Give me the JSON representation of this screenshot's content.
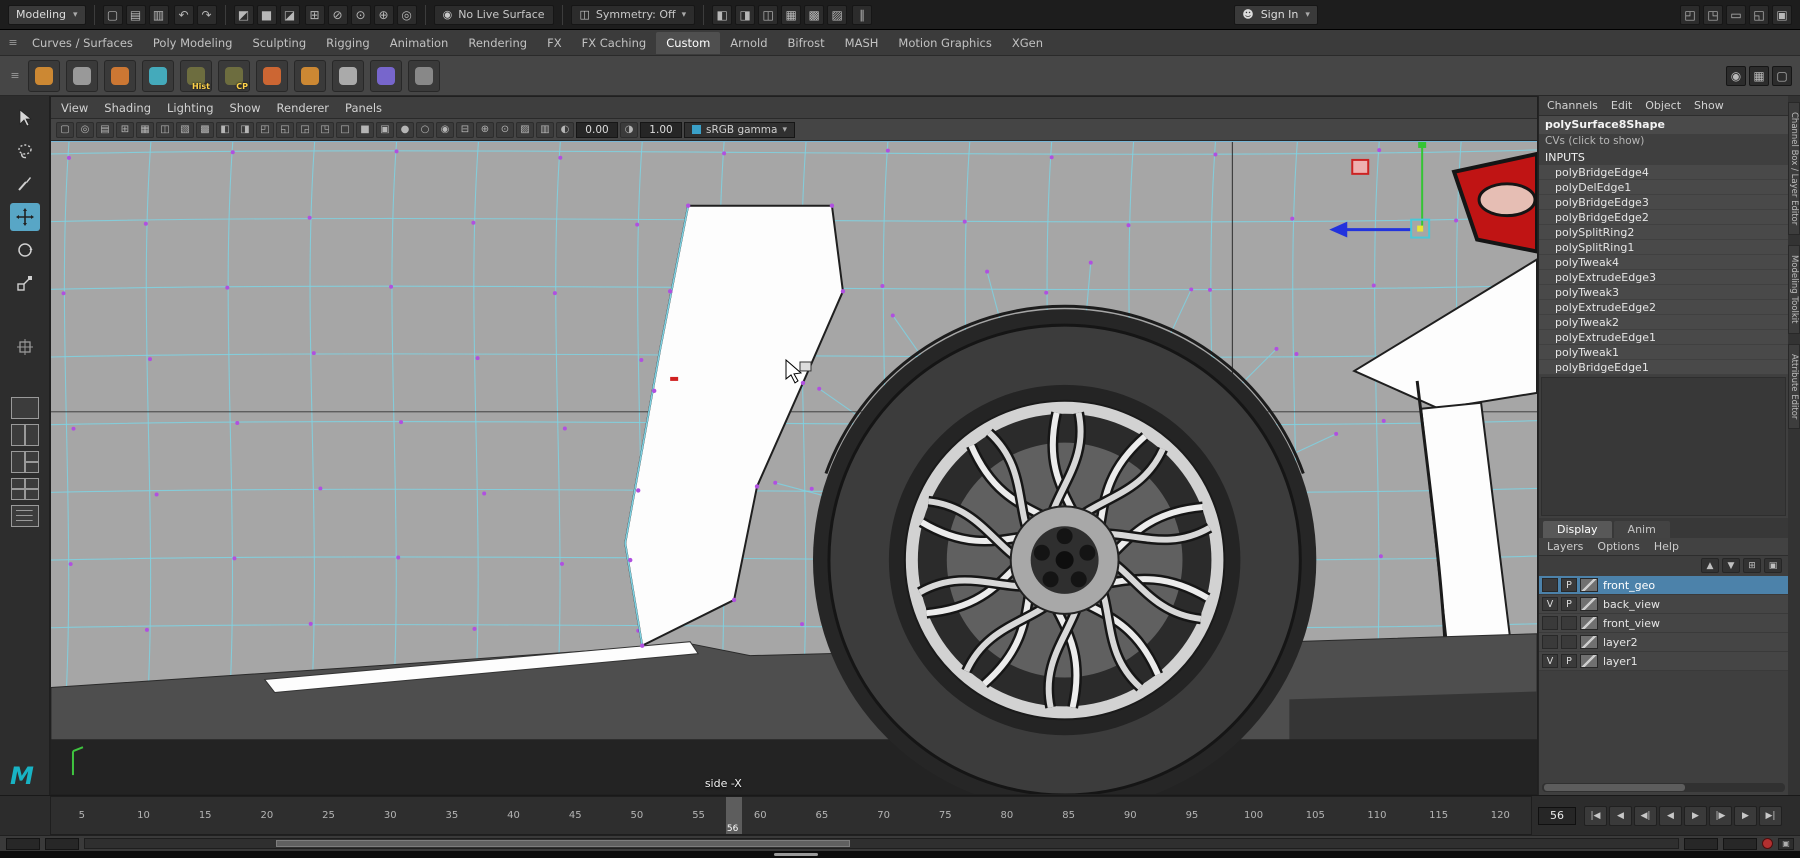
{
  "topbar": {
    "menuset_label": "Modeling",
    "caret": "▾",
    "hamburger_glyph": "≡",
    "live_surface_label": "No Live Surface",
    "symmetry_label": "Symmetry: Off",
    "sign_in_label": "Sign In",
    "pause_glyph": "∥",
    "person_glyph": "☻",
    "live_icon_glyph": "◉",
    "symmetry_icon_glyph": "◫",
    "file_icons": [
      {
        "n": "new-scene-icon",
        "g": "▢"
      },
      {
        "n": "open-scene-icon",
        "g": "▤"
      },
      {
        "n": "save-scene-icon",
        "g": "▥"
      }
    ],
    "undo_icons": [
      {
        "n": "undo-icon",
        "g": "↶"
      },
      {
        "n": "redo-icon",
        "g": "↷"
      }
    ],
    "select_icons": [
      {
        "n": "select-hierarchy-icon",
        "g": "◩"
      },
      {
        "n": "select-object-icon",
        "g": "■"
      },
      {
        "n": "select-component-icon",
        "g": "◪"
      }
    ],
    "snap_icons": [
      {
        "n": "snap-to-grid-icon",
        "g": "⊞"
      },
      {
        "n": "snap-to-curve-icon",
        "g": "⊘"
      },
      {
        "n": "snap-to-point-icon",
        "g": "⊙"
      },
      {
        "n": "snap-to-plane-icon",
        "g": "⊕"
      },
      {
        "n": "make-live-icon",
        "g": "◎"
      }
    ],
    "render_icons": [
      {
        "n": "open-render-view-icon",
        "g": "◧"
      },
      {
        "n": "render-current-frame-icon",
        "g": "◨"
      },
      {
        "n": "ipr-render-icon",
        "g": "◫"
      },
      {
        "n": "render-settings-icon",
        "g": "▦"
      },
      {
        "n": "hypershade-icon",
        "g": "▩"
      },
      {
        "n": "light-editor-icon",
        "g": "▨"
      }
    ],
    "right_icons": [
      {
        "n": "workspace-outliner-icon",
        "g": "◰"
      },
      {
        "n": "workspace-panel-icon",
        "g": "◳"
      },
      {
        "n": "workspace-bar-icon",
        "g": "▭"
      },
      {
        "n": "workspace-split-icon",
        "g": "◱"
      },
      {
        "n": "workspace-full-icon",
        "g": "▣"
      }
    ]
  },
  "shelf": {
    "tabs": [
      {
        "label": "Curves / Surfaces"
      },
      {
        "label": "Poly Modeling"
      },
      {
        "label": "Sculpting"
      },
      {
        "label": "Rigging"
      },
      {
        "label": "Animation"
      },
      {
        "label": "Rendering"
      },
      {
        "label": "FX"
      },
      {
        "label": "FX Caching"
      },
      {
        "label": "Custom",
        "active": true
      },
      {
        "label": "Arnold"
      },
      {
        "label": "Bifrost"
      },
      {
        "label": "MASH"
      },
      {
        "label": "Motion Graphics"
      },
      {
        "label": "XGen"
      }
    ],
    "icons": [
      {
        "n": "shelf-poly-sphere-icon",
        "color": "#cc8833",
        "label": ""
      },
      {
        "n": "shelf-poly-plane-icon",
        "color": "#999999",
        "label": ""
      },
      {
        "n": "shelf-sculpt-icon",
        "color": "#cc7733",
        "label": ""
      },
      {
        "n": "shelf-quad-draw-icon",
        "color": "#44aabb",
        "label": ""
      },
      {
        "n": "shelf-hist-icon",
        "color": "#6d6d3f",
        "label": "Hist"
      },
      {
        "n": "shelf-cp-icon",
        "color": "#6d6d3f",
        "label": "CP"
      },
      {
        "n": "shelf-poly-cube-icon",
        "color": "#cc6633",
        "label": ""
      },
      {
        "n": "shelf-poly-torus-icon",
        "color": "#cc8833",
        "label": ""
      },
      {
        "n": "shelf-node-icon",
        "color": "#aaaaaa",
        "label": ""
      },
      {
        "n": "shelf-lattice-icon",
        "color": "#7766cc",
        "label": ""
      },
      {
        "n": "shelf-project-curve-icon",
        "color": "#888888",
        "label": ""
      }
    ]
  },
  "corner_icons": [
    {
      "n": "panel-corner-camera-icon",
      "g": "◉"
    },
    {
      "n": "panel-corner-grid-icon",
      "g": "▦"
    },
    {
      "n": "panel-corner-pin-icon",
      "g": "▢"
    }
  ],
  "panel_menus": [
    {
      "label": "View"
    },
    {
      "label": "Shading"
    },
    {
      "label": "Lighting"
    },
    {
      "label": "Show"
    },
    {
      "label": "Renderer"
    },
    {
      "label": "Panels"
    }
  ],
  "viewport_toolbar": {
    "icons": [
      {
        "n": "select-camera-icon",
        "g": "▢"
      },
      {
        "n": "lock-camera-icon",
        "g": "◎"
      },
      {
        "n": "camera-attributes-icon",
        "g": "▤"
      },
      {
        "n": "bookmarks-icon",
        "g": "⊞"
      },
      {
        "n": "image-plane-icon",
        "g": "▦"
      },
      {
        "n": "pan-zoom-icon",
        "g": "◫"
      },
      {
        "n": "grease-pencil-icon",
        "g": "▧"
      },
      {
        "n": "grid-icon",
        "g": "▩"
      },
      {
        "n": "film-gate-icon",
        "g": "◧"
      },
      {
        "n": "resolution-gate-icon",
        "g": "◨"
      },
      {
        "n": "gate-mask-icon",
        "g": "◰"
      },
      {
        "n": "field-chart-icon",
        "g": "◱"
      },
      {
        "n": "safe-action-icon",
        "g": "◲"
      },
      {
        "n": "safe-title-icon",
        "g": "◳"
      },
      {
        "n": "wireframe-icon",
        "g": "□"
      },
      {
        "n": "smooth-shade-icon",
        "g": "■"
      },
      {
        "n": "textured-icon",
        "g": "▣"
      },
      {
        "n": "use-default-material-icon",
        "g": "●"
      },
      {
        "n": "shadows-icon",
        "g": "○"
      },
      {
        "n": "ambient-occlusion-icon",
        "g": "◉"
      },
      {
        "n": "motion-blur-icon",
        "g": "⊟"
      },
      {
        "n": "multisample-icon",
        "g": "⊕"
      },
      {
        "n": "depth-of-field-icon",
        "g": "⊙"
      },
      {
        "n": "isolate-select-icon",
        "g": "▨"
      },
      {
        "n": "xray-icon",
        "g": "▥"
      }
    ],
    "exposure_icon_glyph": "◐",
    "contrast_icon_glyph": "◑",
    "exposure_value": "0.00",
    "gamma_value": "1.00",
    "view_transform": "sRGB gamma",
    "caret": "▾"
  },
  "viewport": {
    "camera_label": "side -X"
  },
  "channel_box": {
    "menus": [
      {
        "label": "Channels"
      },
      {
        "label": "Edit"
      },
      {
        "label": "Object"
      },
      {
        "label": "Show"
      }
    ],
    "shape_name": "polySurface8Shape",
    "cvs_label": "CVs (click to show)",
    "inputs_header": "INPUTS",
    "inputs": [
      "polyBridgeEdge4",
      "polyDelEdge1",
      "polyBridgeEdge3",
      "polyBridgeEdge2",
      "polySplitRing2",
      "polySplitRing1",
      "polyTweak4",
      "polyExtrudeEdge3",
      "polyTweak3",
      "polyExtrudeEdge2",
      "polyTweak2",
      "polyExtrudeEdge1",
      "polyTweak1",
      "polyBridgeEdge1"
    ]
  },
  "layer_editor": {
    "tabs": [
      {
        "label": "Display",
        "active": true
      },
      {
        "label": "Anim"
      }
    ],
    "menus": [
      {
        "label": "Layers"
      },
      {
        "label": "Options"
      },
      {
        "label": "Help"
      }
    ],
    "icons": [
      {
        "n": "move-layer-up-icon",
        "g": "▲"
      },
      {
        "n": "move-layer-down-icon",
        "g": "▼"
      },
      {
        "n": "new-empty-layer-icon",
        "g": "⊞"
      },
      {
        "n": "new-layer-from-selected-icon",
        "g": "▣"
      }
    ],
    "layers": [
      {
        "name": "front_geo",
        "v": "",
        "p": "P",
        "selected": true
      },
      {
        "name": "back_view",
        "v": "V",
        "p": "P"
      },
      {
        "name": "front_view",
        "v": "",
        "p": ""
      },
      {
        "name": "layer2",
        "v": "",
        "p": ""
      },
      {
        "name": "layer1",
        "v": "V",
        "p": "P"
      }
    ]
  },
  "side_tabs": [
    {
      "label": "Channel Box / Layer Editor"
    },
    {
      "label": "Modeling Toolkit"
    },
    {
      "label": "Attribute Editor"
    }
  ],
  "timeline": {
    "ticks": [
      "5",
      "10",
      "15",
      "20",
      "25",
      "30",
      "35",
      "40",
      "45",
      "50",
      "55",
      "60",
      "65",
      "70",
      "75",
      "80",
      "85",
      "90",
      "95",
      "100",
      "105",
      "110",
      "115",
      "120"
    ],
    "current_frame": "56",
    "current_frame_field": "56",
    "transport": [
      {
        "n": "go-to-start-button",
        "g": "|◀"
      },
      {
        "n": "step-back-frame-button",
        "g": "◀"
      },
      {
        "n": "step-back-key-button",
        "g": "◀|"
      },
      {
        "n": "play-backwards-button",
        "g": "◀"
      },
      {
        "n": "play-forwards-button",
        "g": "▶"
      },
      {
        "n": "step-forward-key-button",
        "g": "|▶"
      },
      {
        "n": "step-forward-frame-button",
        "g": "▶"
      },
      {
        "n": "go-to-end-button",
        "g": "▶|"
      }
    ]
  },
  "colors": {
    "accent_blue": "#58a6c6",
    "selection_cyan": "#7fd2e2",
    "vertex_purple": "#b050e0",
    "selected_layer": "#4c82aa",
    "maya_teal": "#18b3c4",
    "tail_light_red": "#c01414"
  }
}
